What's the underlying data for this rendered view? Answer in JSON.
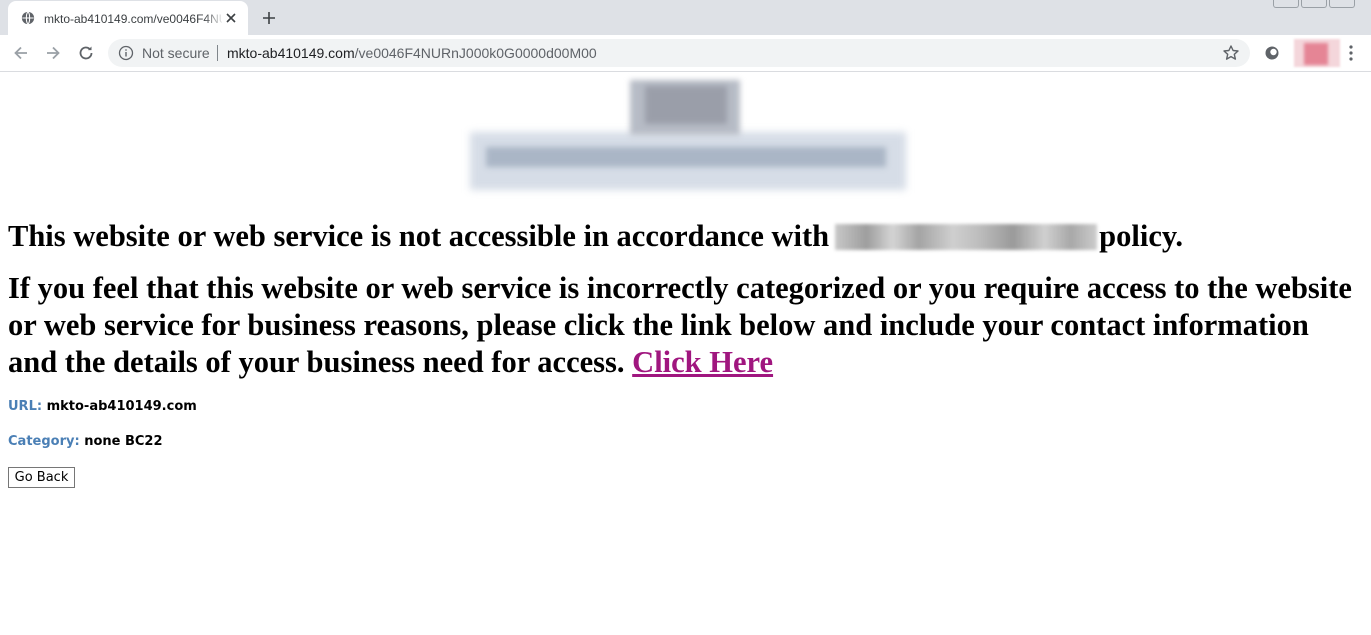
{
  "browser": {
    "tab": {
      "title": "mkto-ab410149.com/ve0046F4NURnJ000k0G0000d00M00"
    },
    "address_bar": {
      "security_label": "Not secure",
      "url_host": "mkto-ab410149.com",
      "url_path": "/ve0046F4NURnJ000k0G0000d00M00"
    },
    "icons": {
      "favicon": "globe-icon",
      "close": "close-icon",
      "new_tab": "plus-icon",
      "back": "back-arrow-icon",
      "forward": "forward-arrow-icon",
      "reload": "reload-icon",
      "info": "info-icon",
      "bookmark": "star-icon",
      "extension": "extension-icon",
      "profile": "profile-avatar",
      "menu": "kebab-menu-icon"
    }
  },
  "page": {
    "policy_before": "This website or web service is not accessible in accordance with",
    "policy_after": "policy.",
    "request_text": "If you feel that this website or web service is incorrectly categorized or you require access to the website or web service for business reasons, please click the link below and include your contact information and the details of your business need for access.",
    "link_label": "Click Here",
    "url_label": "URL:",
    "url_value": "mkto-ab410149.com",
    "category_label": "Category:",
    "category_value": "none BC22",
    "go_back_label": "Go Back"
  },
  "colors": {
    "label_blue": "#4a7fb5",
    "link_visited": "#a0167f"
  }
}
